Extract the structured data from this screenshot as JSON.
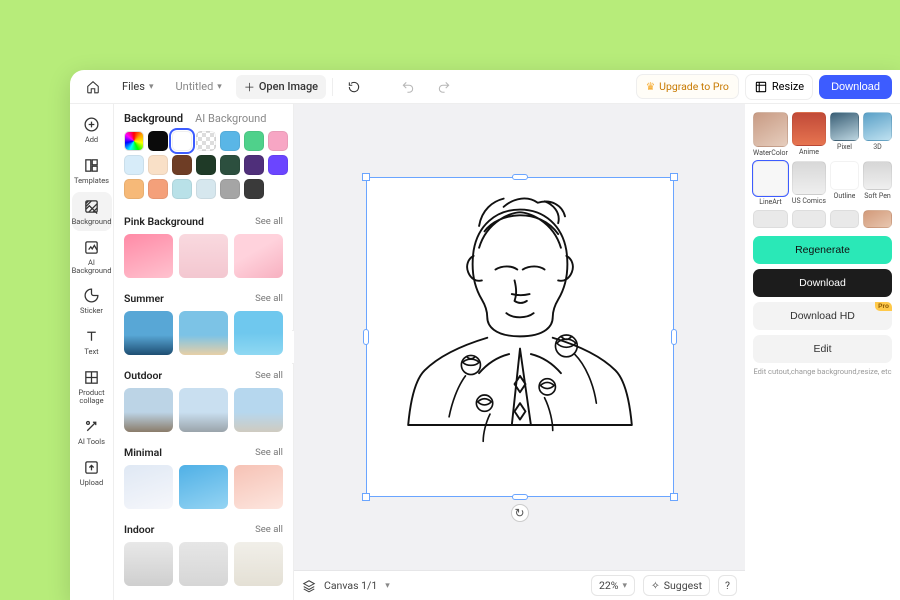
{
  "header": {
    "files_label": "Files",
    "doc_name": "Untitled",
    "open_image": "Open Image",
    "upgrade": "Upgrade to Pro",
    "resize": "Resize",
    "download": "Download"
  },
  "rail": {
    "add": "Add",
    "templates": "Templates",
    "background": "Background",
    "ai_background": "AI\nBackground",
    "sticker": "Sticker",
    "text": "Text",
    "product_collage": "Product\ncollage",
    "ai_tools": "AI Tools",
    "upload": "Upload"
  },
  "panel": {
    "tab_background": "Background",
    "tab_ai_background": "AI Background",
    "see_all": "See all",
    "swatches": [
      "rainbow",
      "#0b0b0b",
      "sel-white",
      "checker",
      "#5ab6e6",
      "#4fd18b",
      "#f7a6c4",
      "#d7ecf9",
      "#f9e0c7",
      "#6e3d25",
      "#1f3a27",
      "#2c4f3e",
      "#4f2f7a",
      "#6b45ff",
      "#f6b978",
      "#f4a07a",
      "#b9e1e8",
      "#d6e7ee",
      "#a5a5a5",
      "#3a3a3a"
    ],
    "cats": [
      {
        "title": "Pink Background",
        "thumbs": [
          "linear-gradient(160deg,#ff8aa6,#ffc2cf)",
          "linear-gradient(#f9d9df,#f3c7d0)",
          "linear-gradient(150deg,#ffd2dc 40%,#f7b0c0)"
        ]
      },
      {
        "title": "Summer",
        "thumbs": [
          "linear-gradient(#58a7d6 55%,#1e4e72)",
          "linear-gradient(#7cc3e6 55%,#e7cfa6)",
          "linear-gradient(#6fc8ee 50%,#8fd8f2)"
        ]
      },
      {
        "title": "Outdoor",
        "thumbs": [
          "linear-gradient(#bcd4e6 55%,#8a7c6a)",
          "linear-gradient(#c9dff0 55%,#9aa3aa)",
          "linear-gradient(#b6d7ee 55%,#cfcbc0)"
        ]
      },
      {
        "title": "Minimal",
        "thumbs": [
          "linear-gradient(160deg,#dfe8f4,#f6f7fb)",
          "linear-gradient(160deg,#4fb0e6,#95d4f3)",
          "linear-gradient(160deg,#f6c2b5,#fde6df)"
        ]
      },
      {
        "title": "Indoor",
        "thumbs": [
          "linear-gradient(#e8e8e8,#cfcfcf)",
          "linear-gradient(#e6e6e6,#d6d6d6)",
          "linear-gradient(#f1efe9,#e4e0d5)"
        ]
      }
    ]
  },
  "stage": {
    "canvas_label": "Canvas 1/1",
    "zoom": "22%",
    "suggest": "Suggest",
    "help": "?"
  },
  "right": {
    "styles_row1": [
      "WaterColor",
      "Anime",
      "Pixel",
      "3D"
    ],
    "styles_row2": [
      "LineArt",
      "US Comics",
      "Outline",
      "Soft Pen"
    ],
    "regen": "Regenerate",
    "download": "Download",
    "download_hd": "Download HD",
    "pro": "Pro",
    "edit": "Edit",
    "edit_hint": "Edit cutout,change background,resize, etc"
  },
  "style_colors": {
    "row1": [
      "linear-gradient(150deg,#c89b84,#e6cdbd)",
      "linear-gradient(#c14a38,#e67450)",
      "linear-gradient(160deg,#3a5f76,#bcd5e0)",
      "linear-gradient(160deg,#5aa0c7,#bfe1f0)"
    ],
    "row2": [
      "#f7f7f7",
      "linear-gradient(#d8d8d8,#efefef)",
      "#ffffff",
      "linear-gradient(#d6d6d6,#efefef)"
    ],
    "row3": [
      "#e9e9e9",
      "#e9e9e9",
      "#e9e9e9",
      "linear-gradient(150deg,#d29a7a,#e8c6af)"
    ]
  }
}
